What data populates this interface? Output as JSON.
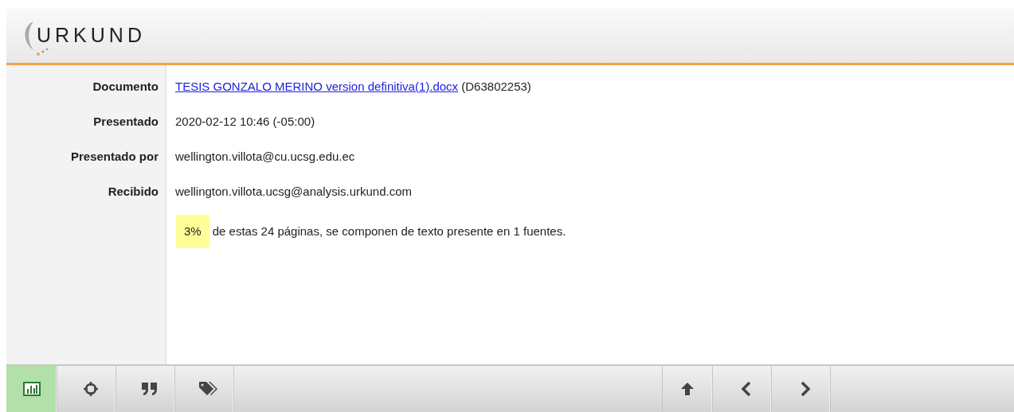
{
  "header": {
    "logo": "URKUND"
  },
  "details": [
    {
      "label": "Documento",
      "kind": "link",
      "value": "TESIS GONZALO MERINO version definitiva(1).docx",
      "suffix": "(D63802253)"
    },
    {
      "label": "Presentado",
      "kind": "text",
      "value": "2020-02-12 10:46 (-05:00)"
    },
    {
      "label": "Presentado por",
      "kind": "text",
      "value": "wellington.villota@cu.ucsg.edu.ec"
    },
    {
      "label": "Recibido",
      "kind": "text",
      "value": "wellington.villota.ucsg@analysis.urkund.com"
    }
  ],
  "summary": {
    "percent": "3%",
    "text": "de estas 24 páginas, se componen de texto presente en 1 fuentes."
  },
  "toolbar": {
    "left": [
      {
        "kind": "chart",
        "selected": true
      },
      {
        "kind": "target",
        "selected": false
      },
      {
        "kind": "quote",
        "selected": false
      },
      {
        "kind": "tags",
        "selected": false
      }
    ],
    "right": [
      {
        "kind": "up",
        "selected": false
      },
      {
        "kind": "prev",
        "selected": false
      },
      {
        "kind": "next",
        "selected": false
      }
    ]
  }
}
